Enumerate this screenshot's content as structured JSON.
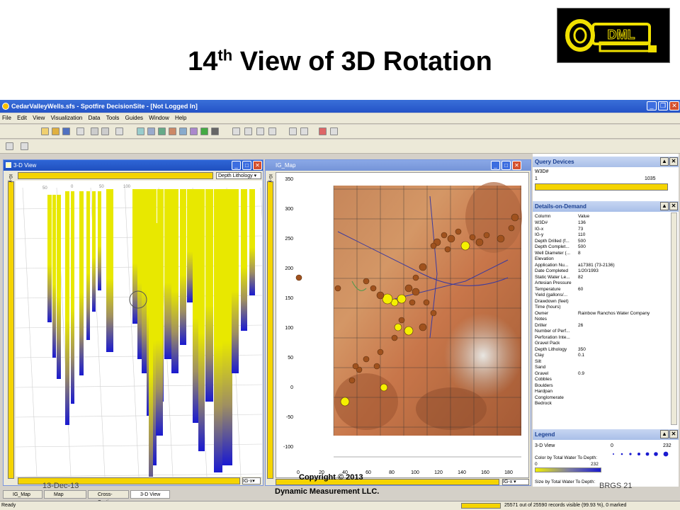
{
  "slide": {
    "title_main": "14",
    "title_sup": "th",
    "title_rest": " View of 3D Rotation",
    "logo_text": "DML",
    "footer_date": "13-Dec-13",
    "footer_copyright_line1": "Copyright © 2013",
    "footer_copyright_line2": "Dynamic Measurement LLC.",
    "footer_page": "BRGS  21"
  },
  "window": {
    "title": "CedarValleyWells.sfs - Spotfire DecisionSite - [Not Logged In]"
  },
  "menu": [
    "File",
    "Edit",
    "View",
    "Visualization",
    "Data",
    "Tools",
    "Guides",
    "Window",
    "Help"
  ],
  "view3d": {
    "title": "3-D View",
    "color_dropdown": "Depth Lithology",
    "y_axis_label": "IG-y",
    "x_axis_label": "IG-x",
    "top_ticks": [
      "50",
      "0",
      "50",
      "100"
    ]
  },
  "map": {
    "title": "IG_Map",
    "y_axis_label": "IG-y",
    "x_axis_label": "IG-x",
    "y_ticks": [
      "350",
      "300",
      "250",
      "200",
      "150",
      "100",
      "50",
      "0",
      "-50",
      "-100"
    ],
    "x_ticks": [
      "0",
      "20",
      "40",
      "60",
      "80",
      "100",
      "120",
      "140",
      "160",
      "180"
    ]
  },
  "query_devices": {
    "title": "Query Devices",
    "field": "W3D#",
    "min": "1",
    "max": "1035"
  },
  "details": {
    "title": "Details-on-Demand",
    "col_header": "Column",
    "val_header": "Value",
    "rows": [
      [
        "W3D#",
        "136"
      ],
      [
        "IG-x",
        "73"
      ],
      [
        "IG-y",
        "110"
      ],
      [
        "Depth Drilled (f...",
        "500"
      ],
      [
        "Depth Complet...",
        "500"
      ],
      [
        "Well Diameter (...",
        "8"
      ],
      [
        "Elevation",
        ""
      ],
      [
        "Application Nu...",
        "a17381 (73-2136)"
      ],
      [
        "Date Completed",
        "1/20/1993"
      ],
      [
        "Static Water Le...",
        "82"
      ],
      [
        "Artesian Pressure",
        ""
      ],
      [
        "Temperature",
        "60"
      ],
      [
        "Yield (gallons/...",
        ""
      ],
      [
        "Drawdown (feet)",
        ""
      ],
      [
        "Time (hours)",
        ""
      ],
      [
        "Owner",
        "Rainbow Ranchos Water Company"
      ],
      [
        "Notes",
        ""
      ],
      [
        "Driller",
        "26"
      ],
      [
        "Number of Perf...",
        ""
      ],
      [
        "Perforation Inte...",
        ""
      ],
      [
        "Gravel Pack",
        ""
      ],
      [
        "Depth Lithology",
        "350"
      ],
      [
        "Clay",
        "0.1"
      ],
      [
        "Silt",
        ""
      ],
      [
        "Sand",
        ""
      ],
      [
        "Gravel",
        "0.9"
      ],
      [
        "Cobbles",
        ""
      ],
      [
        "Boulders",
        ""
      ],
      [
        "Hardpan",
        ""
      ],
      [
        "Conglomerate",
        ""
      ],
      [
        "Bedrock",
        ""
      ]
    ]
  },
  "legend": {
    "title": "Legend",
    "view": "3-D View",
    "size_min": "0",
    "size_max": "232",
    "color_label": "Color by Total Water To Depth:",
    "color_min": "0",
    "color_max": "232",
    "size_label": "Size by Total Water To Depth:"
  },
  "tabs": [
    "IG_Map",
    "Map",
    "Cross-Section",
    "3-D View"
  ],
  "status": {
    "left": "Ready",
    "records": "25571 out of 25590 records visible (99.93 %), 0 marked"
  },
  "colors": {
    "well_yellow": "#e8e800",
    "well_blue": "#1a1ad0",
    "dot_brown": "#a0521e",
    "dot_yellow": "#f5f000"
  }
}
